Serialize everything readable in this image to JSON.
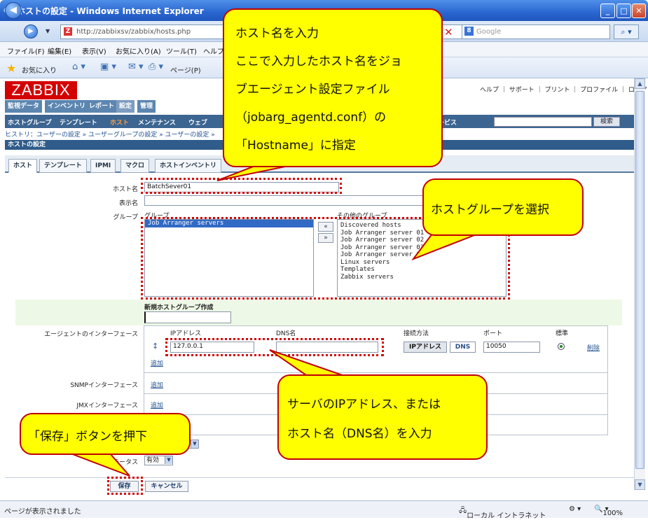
{
  "browser": {
    "title": "ホストの設定 - Windows Internet Explorer",
    "url": "http://zabbixsv/zabbix/hosts.php",
    "search_placeholder": "Google",
    "menu": [
      "ファイル(F)",
      "編集(E)",
      "表示(V)",
      "お気に入り(A)",
      "ツール(T)",
      "ヘルプ"
    ],
    "favorites_label": "お気に入り",
    "page_menu": "ページ(P)",
    "status_text": "ページが表示されました",
    "zone": "ローカル イントラネット",
    "zoom": "100%"
  },
  "zabbix": {
    "logo": "ZABBIX",
    "top_links": "ヘルプ ｜ サポート ｜ プリント ｜ プロファイル ｜ ログアウト",
    "main_menu": [
      "監視データ",
      "インベントリ",
      "レポート",
      "設定",
      "管理"
    ],
    "main_menu_selected": "設定",
    "sub_menu": [
      "ホストグループ",
      "テンプレート",
      "ホスト",
      "メンテナンス",
      "ウェブ"
    ],
    "sub_menu_tail": "ービス",
    "sub_menu_selected": "ホスト",
    "search_button": "検索",
    "history": "ヒストリ：ユーザーの設定 » ユーザーグループの設定 » ユーザーの設定 »",
    "section_title": "ホストの設定",
    "tabs": [
      "ホスト",
      "テンプレート",
      "IPMI",
      "マクロ",
      "ホストインベントリ"
    ],
    "form": {
      "hostname_label": "ホスト名",
      "hostname_value": "BatchSever01",
      "visible_name_label": "表示名",
      "group_label": "グループ",
      "groups_header": "グループ",
      "other_groups_header": "その他のグループ",
      "groups": [
        "Job Arranger servers"
      ],
      "other_groups": [
        "Discovered hosts",
        "Job Arranger server 01",
        "Job Arranger server 02",
        "Job Arranger server 03",
        "Job Arranger server 04",
        "Linux servers",
        "Templates",
        "Zabbix servers"
      ],
      "move_left": "«",
      "move_right": "»",
      "new_group_label": "新規ホストグループ作成",
      "agent_if_label": "エージェントのインターフェース",
      "ip_header": "IPアドレス",
      "dns_header": "DNS名",
      "connect_header": "接続方法",
      "port_header": "ポート",
      "default_header": "標準",
      "ip_value": "127.0.0.1",
      "dns_value": "",
      "connect_ip": "IPアドレス",
      "connect_dns": "DNS",
      "port_value": "10050",
      "remove_link": "削除",
      "add_link": "追加",
      "snmp_label": "SNMPインターフェース",
      "jmx_label": "JMXインターフェース",
      "status_label": "ステータス",
      "status_value": "有効",
      "save_button": "保存",
      "cancel_button": "キャンセル"
    }
  },
  "callouts": {
    "hostname": [
      "ホスト名を入力",
      "ここで入力したホスト名をジョ",
      "ブエージェント設定ファイル",
      "（jobarg_agentd.conf）の",
      "「Hostname」に指定"
    ],
    "group": "ホストグループを選択",
    "ip": [
      "サーバのIPアドレス、または",
      "ホスト名（DNS名）を入力"
    ],
    "save": "「保存」ボタンを押下"
  },
  "colors": {
    "callout_fill": "#ffff00",
    "callout_border": "#c00000",
    "zabbix_red": "#d40000",
    "menu_blue": "#3c6591"
  }
}
